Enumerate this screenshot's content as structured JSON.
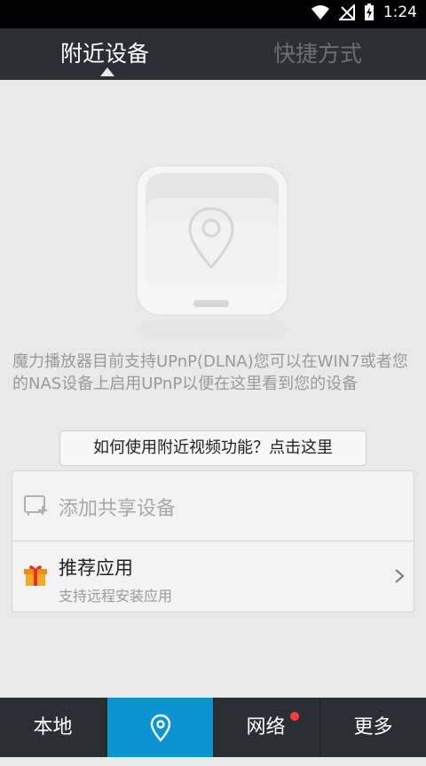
{
  "status_bar": {
    "time": "1:24"
  },
  "tabs": [
    {
      "label": "附近设备",
      "active": true
    },
    {
      "label": "快捷方式",
      "active": false
    }
  ],
  "main": {
    "description": "魔力播放器目前支持UPnP(DLNA)您可以在WIN7或者您的NAS设备上启用UPnP以便在这里看到您的设备",
    "howto_button": "如何使用附近视频功能？点击这里",
    "items": [
      {
        "label": "添加共享设备",
        "icon": "add-device-icon"
      },
      {
        "label": "推荐应用",
        "subtitle": "支持远程安装应用",
        "icon": "gift-icon"
      }
    ]
  },
  "bottom_nav": [
    {
      "label": "本地"
    },
    {
      "label": "",
      "icon": "location-pin-icon",
      "active": true
    },
    {
      "label": "网络",
      "badge": true
    },
    {
      "label": "更多"
    }
  ],
  "colors": {
    "accent": "#0a95d2",
    "bar": "#2b2f33",
    "badge": "#ff3b3b"
  }
}
